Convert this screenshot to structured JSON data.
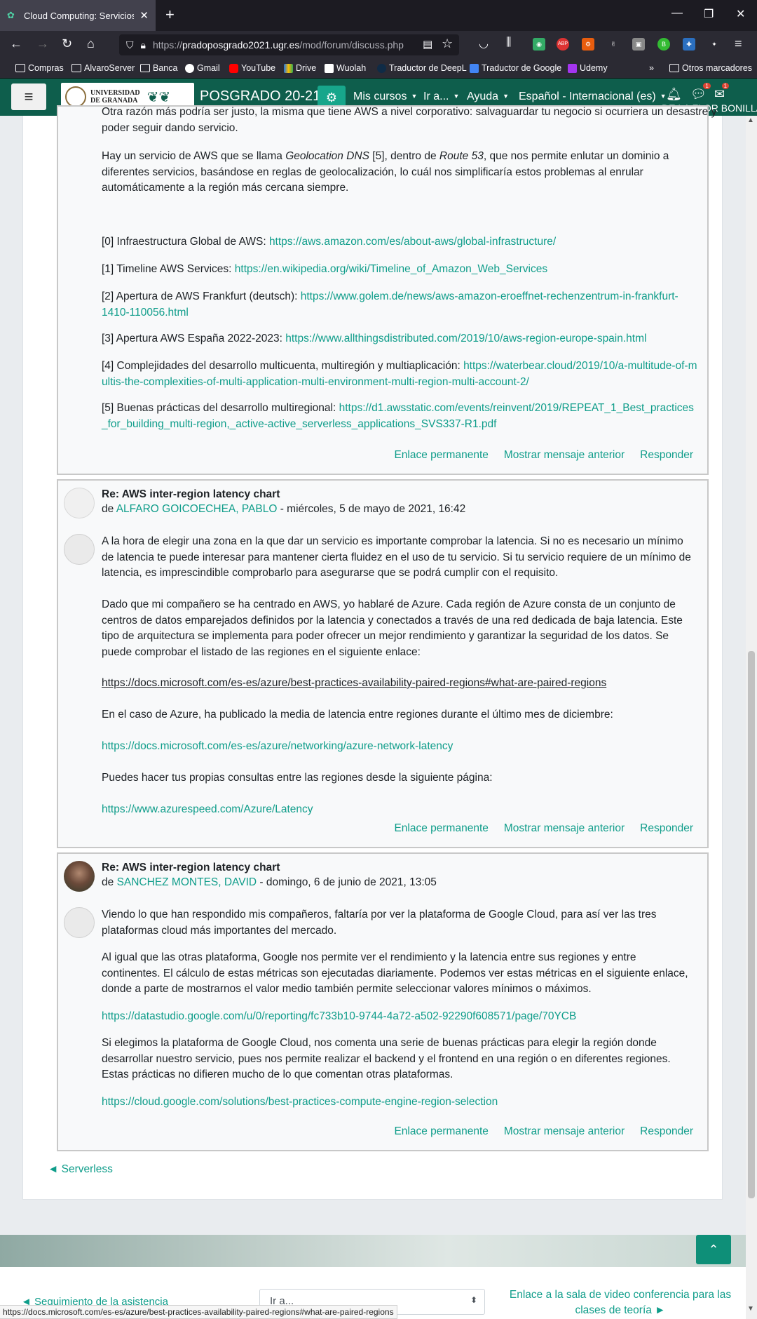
{
  "browser": {
    "tab_title": "Cloud Computing: Servicios y A",
    "url_prefix": "https://",
    "url_domain": "pradoposgrado2021.ugr.es",
    "url_path": "/mod/forum/discuss.php",
    "bookmarks": [
      "Compras",
      "AlvaroServer",
      "Banca",
      "Gmail",
      "YouTube",
      "Drive",
      "Wuolah",
      "Traductor de DeepL",
      "Traductor de Google",
      "Udemy"
    ],
    "other_bookmarks": "Otros marcadores",
    "status_url": "https://docs.microsoft.com/es-es/azure/best-practices-availability-paired-regions#what-are-paired-regions"
  },
  "nav": {
    "university_line1": "UNIVERSIDAD",
    "university_line2": "DE GRANADA",
    "site_name": "POSGRADO 20-21",
    "mis_cursos": "Mis cursos",
    "ir_a": "Ir a...",
    "ayuda": "Ayuda",
    "language": "Español - Internacional (es)",
    "user_name": "DE LA FLOR BONILLA",
    "badge_notifications": "1",
    "badge_messages": "1"
  },
  "post1": {
    "cut_line": "Otra razón más podría ser justo, la misma que tiene AWS a nivel corporativo: salvaguardar tu negocio si ocurriera un desastre y",
    "para1_end": "poder seguir dando servicio.",
    "geo_pre": "Hay un servicio de AWS que se llama ",
    "geo_term": "Geolocation DNS",
    "geo_mid": " [5], dentro de ",
    "geo_route": "Route 53",
    "geo_post": ", que nos permite enlutar un dominio a diferentes servicios, basándose en reglas de geolocalización, lo cuál nos simplificaría estos problemas al enrular automáticamente a la región más cercana siempre.",
    "refs": [
      {
        "label": "[0] Infraestructura Global de AWS: ",
        "link": "https://aws.amazon.com/es/about-aws/global-infrastructure/"
      },
      {
        "label": "[1] Timeline AWS Services: ",
        "link": "https://en.wikipedia.org/wiki/Timeline_of_Amazon_Web_Services"
      },
      {
        "label": "[2] Apertura de AWS Frankfurt (deutsch): ",
        "link": "https://www.golem.de/news/aws-amazon-eroeffnet-rechenzentrum-in-frankfurt-1410-110056.html"
      },
      {
        "label": "[3] Apertura AWS España 2022-2023: ",
        "link": "https://www.allthingsdistributed.com/2019/10/aws-region-europe-spain.html"
      },
      {
        "label": "[4] Complejidades del desarrollo multicuenta, multiregión y multiaplicación: ",
        "link": "https://waterbear.cloud/2019/10/a-multitude-of-multis-the-complexities-of-multi-application-multi-environment-multi-region-multi-account-2/"
      },
      {
        "label": "[5] Buenas prácticas del desarrollo multiregional: ",
        "link": "https://d1.awsstatic.com/events/reinvent/2019/REPEAT_1_Best_practices_for_building_multi-region,_active-active_serverless_applications_SVS337-R1.pdf"
      }
    ]
  },
  "actions": {
    "permalink": "Enlace permanente",
    "show_parent": "Mostrar mensaje anterior",
    "reply": "Responder"
  },
  "post2": {
    "title": "Re: AWS inter-region latency chart",
    "by": "de ",
    "author": "ALFARO GOICOECHEA, PABLO",
    "date": " - miércoles, 5 de mayo de 2021, 16:42",
    "p1": "A la hora de elegir una zona en la que dar un servicio es importante comprobar la latencia. Si no es necesario un mínimo de latencia te puede interesar para mantener cierta fluidez en el uso de tu servicio. Si tu servicio requiere de un mínimo de latencia, es imprescindible comprobarlo para asegurarse que se podrá cumplir con el requisito.",
    "p2": "Dado que mi compañero se ha centrado en AWS, yo hablaré de Azure. Cada región de Azure consta de un conjunto de centros de datos emparejados definidos por la latencia y conectados a través de una red dedicada de baja latencia. Este tipo de arquitectura se implementa para poder ofrecer un mejor rendimiento y garantizar la seguridad de los datos. Se puede comprobar el listado de las regiones en el siguiente enlace:",
    "link1": "https://docs.microsoft.com/es-es/azure/best-practices-availability-paired-regions#what-are-paired-regions",
    "p3": "En el caso de Azure, ha publicado la media de latencia entre regiones durante el último mes de diciembre:",
    "link2": "https://docs.microsoft.com/es-es/azure/networking/azure-network-latency",
    "p4": "Puedes hacer tus propias consultas entre las regiones desde la siguiente página:",
    "link3": "https://www.azurespeed.com/Azure/Latency"
  },
  "post3": {
    "title": "Re: AWS inter-region latency chart",
    "by": "de ",
    "author": "SANCHEZ MONTES, DAVID",
    "date": " - domingo, 6 de junio de 2021, 13:05",
    "p1": "Viendo lo que han respondido mis compañeros, faltaría por ver la plataforma de Google Cloud, para así ver las tres plataformas cloud más importantes del mercado.",
    "p2": "Al igual que las otras plataforma, Google nos permite ver el rendimiento y la latencia entre sus regiones y entre continentes. El cálculo de estas métricas son ejecutadas diariamente. Podemos ver estas métricas en el siguiente enlace, donde a parte de mostrarnos el valor medio también permite seleccionar valores mínimos o máximos.",
    "link1": "https://datastudio.google.com/u/0/reporting/fc733b10-9744-4a72-a502-92290f608571/page/70YCB",
    "p3": "Si elegimos la plataforma de Google Cloud, nos comenta una serie de buenas prácticas para elegir la región donde desarrollar nuestro servicio, pues nos permite realizar el backend y el frontend en una región o en diferentes regiones. Estas prácticas no difieren mucho de lo que comentan otras plataformas.",
    "link2": "https://cloud.google.com/solutions/best-practices-compute-engine-region-selection"
  },
  "footer": {
    "prev_link": "◄ Serverless",
    "seguimiento": "◄ Seguimiento de la asistencia",
    "jump_select": "Ir a...",
    "video_link": "Enlace a la sala de video conferencia para las clases de teoría ►"
  }
}
